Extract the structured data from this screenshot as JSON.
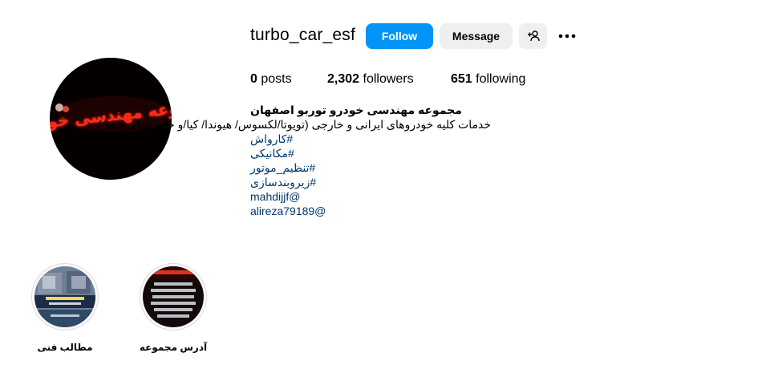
{
  "profile": {
    "username": "turbo_car_esf",
    "avatar_sign_text": "مجموعه مهندسی خودرو"
  },
  "actions": {
    "follow_label": "Follow",
    "message_label": "Message",
    "suggest_icon": "add-person-icon",
    "more_icon": "more-options-icon"
  },
  "stats": {
    "posts_count": "0",
    "posts_label": "posts",
    "followers_count": "2,302",
    "followers_label": "followers",
    "following_count": "651",
    "following_label": "following"
  },
  "bio": {
    "full_name": "مجموعه مهندسی خودرو توربو اصفهان",
    "description": "خدمات کلیه خودروهای ایرانی و خارجی (تویوتا/لکسوس/ هیوندا/ کیا/و خودروهای چینی)",
    "hashtags": [
      "#کارواش",
      "#مکانیکی",
      "#تنظیم_موتور",
      "#زیروبندسازی"
    ],
    "mentions": [
      "mahdijjf@",
      "alireza79189@"
    ]
  },
  "highlights": [
    {
      "label": "مطالب فنی"
    },
    {
      "label": "آدرس مجموعه"
    }
  ],
  "colors": {
    "accent_blue": "#0095f6",
    "secondary_button": "#efefef",
    "link": "#00376b",
    "neon_red": "#ff2a1a"
  }
}
